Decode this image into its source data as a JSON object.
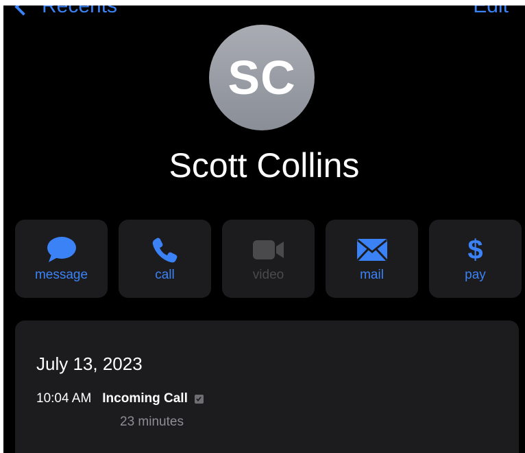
{
  "nav": {
    "back_label": "Recents",
    "edit_label": "Edit"
  },
  "contact": {
    "initials": "SC",
    "name": "Scott Collins"
  },
  "actions": [
    {
      "label": "message",
      "icon": "message-bubble-icon",
      "enabled": true
    },
    {
      "label": "call",
      "icon": "phone-icon",
      "enabled": true
    },
    {
      "label": "video",
      "icon": "video-camera-icon",
      "enabled": false
    },
    {
      "label": "mail",
      "icon": "envelope-icon",
      "enabled": true
    },
    {
      "label": "pay",
      "icon": "dollar-icon",
      "enabled": true
    }
  ],
  "history": {
    "date": "July 13, 2023",
    "call_time": "10:04 AM",
    "call_type": "Incoming Call",
    "duration": "23 minutes"
  },
  "colors": {
    "accent": "#3b82f6",
    "background": "#000000",
    "card": "#1c1c1e",
    "disabled": "#4a4a4d",
    "secondary_text": "#8e8e93"
  }
}
